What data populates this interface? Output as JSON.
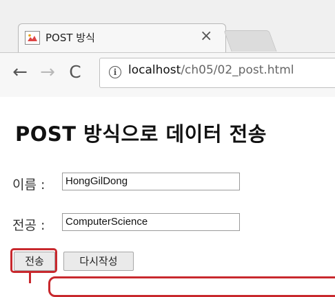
{
  "browser": {
    "tab_title": "POST 방식",
    "tab_close": "×",
    "url_host": "localhost",
    "url_path": "/ch05/02_post.html",
    "back_icon": "←",
    "forward_icon": "→",
    "reload_icon": "C"
  },
  "page": {
    "title": "POST 방식으로 데이터 전송",
    "fields": [
      {
        "label": "이름 :",
        "value": "HongGilDong"
      },
      {
        "label": "전공 :",
        "value": "ComputerScience"
      }
    ],
    "submit_label": "전송",
    "reset_label": "다시작성"
  },
  "colors": {
    "highlight": "#c8282d"
  }
}
